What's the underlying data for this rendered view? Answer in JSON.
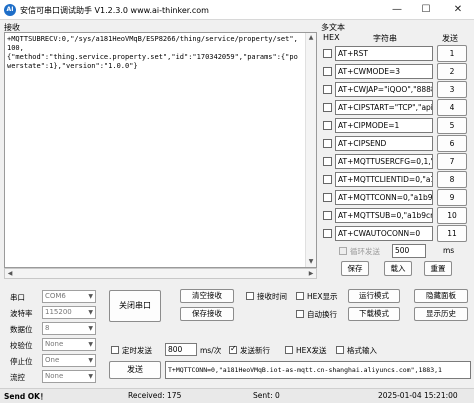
{
  "window": {
    "title": "安信可串口调试助手 V1.2.3.0    www.ai-thinker.com",
    "icon_letter": "AI",
    "minimize": "—",
    "maximize": "☐",
    "close": "✕"
  },
  "receive": {
    "label": "接收",
    "text": "+MQTTSUBRECV:0,\"/sys/a181HeoVMqB/ESP8266/thing/service/property/set\",100,\n{\"method\":\"thing.service.property.set\",\"id\":\"170342059\",\"params\":{\"powerstate\":1},\"version\":\"1.0.0\"}"
  },
  "multi_text": {
    "title": "多文本",
    "col_hex": "HEX",
    "col_string": "字符串",
    "col_send": "发送",
    "rows": [
      {
        "cmd": "AT+RST",
        "btn": "1"
      },
      {
        "cmd": "AT+CWMODE=3",
        "btn": "2"
      },
      {
        "cmd": "AT+CWJAP=\"iQOO\",\"8888",
        "btn": "3"
      },
      {
        "cmd": "AT+CIPSTART=\"TCP\",\"api.",
        "btn": "4"
      },
      {
        "cmd": "AT+CIPMODE=1",
        "btn": "5"
      },
      {
        "cmd": "AT+CIPSEND",
        "btn": "6"
      },
      {
        "cmd": "AT+MQTTUSERCFG=0,1,\"",
        "btn": "7"
      },
      {
        "cmd": "AT+MQTTCLIENTID=0,\"a1",
        "btn": "8"
      },
      {
        "cmd": "AT+MQTTCONN=0,\"a1b9o",
        "btn": "9"
      },
      {
        "cmd": "AT+MQTTSUB=0,\"a1b9cr",
        "btn": "10"
      },
      {
        "cmd": "AT+CWAUTOCONN=0",
        "btn": "11"
      }
    ],
    "loop_label": "循环发送",
    "loop_interval": "500",
    "loop_unit": "ms",
    "save": "保存",
    "load": "载入",
    "reset": "重置"
  },
  "serial": {
    "port_label": "串口",
    "port_value": "COM6",
    "baud_label": "波特率",
    "baud_value": "115200",
    "databits_label": "数据位",
    "databits_value": "8",
    "parity_label": "校验位",
    "parity_value": "None",
    "stopbits_label": "停止位",
    "stopbits_value": "One",
    "flow_label": "流控",
    "flow_value": "None",
    "open_btn": "关闭串口"
  },
  "controls": {
    "clear_recv": "清空接收",
    "save_recv": "保存接收",
    "recv_time": "接收时间",
    "hex_display": "HEX显示",
    "run_mode": "运行模式",
    "hide_panel": "隐藏面板",
    "auto_newline": "自动换行",
    "download_mode": "下载模式",
    "show_history": "显示历史",
    "timed_send": "定时发送",
    "timed_value": "800",
    "timed_unit": "ms/次",
    "send_newline": "发送新行",
    "hex_send": "HEX发送",
    "format_input": "格式输入",
    "send_btn": "发送",
    "send_text": "T+MQTTCONN=0,\"a181HeoVMqB.iot-as-mqtt.cn-shanghai.aliyuncs.com\",1883,1"
  },
  "status": {
    "state": "Send OK！",
    "received": "Received: 175",
    "sent": "Sent: 0",
    "time": "2025-01-04 15:21:00"
  }
}
